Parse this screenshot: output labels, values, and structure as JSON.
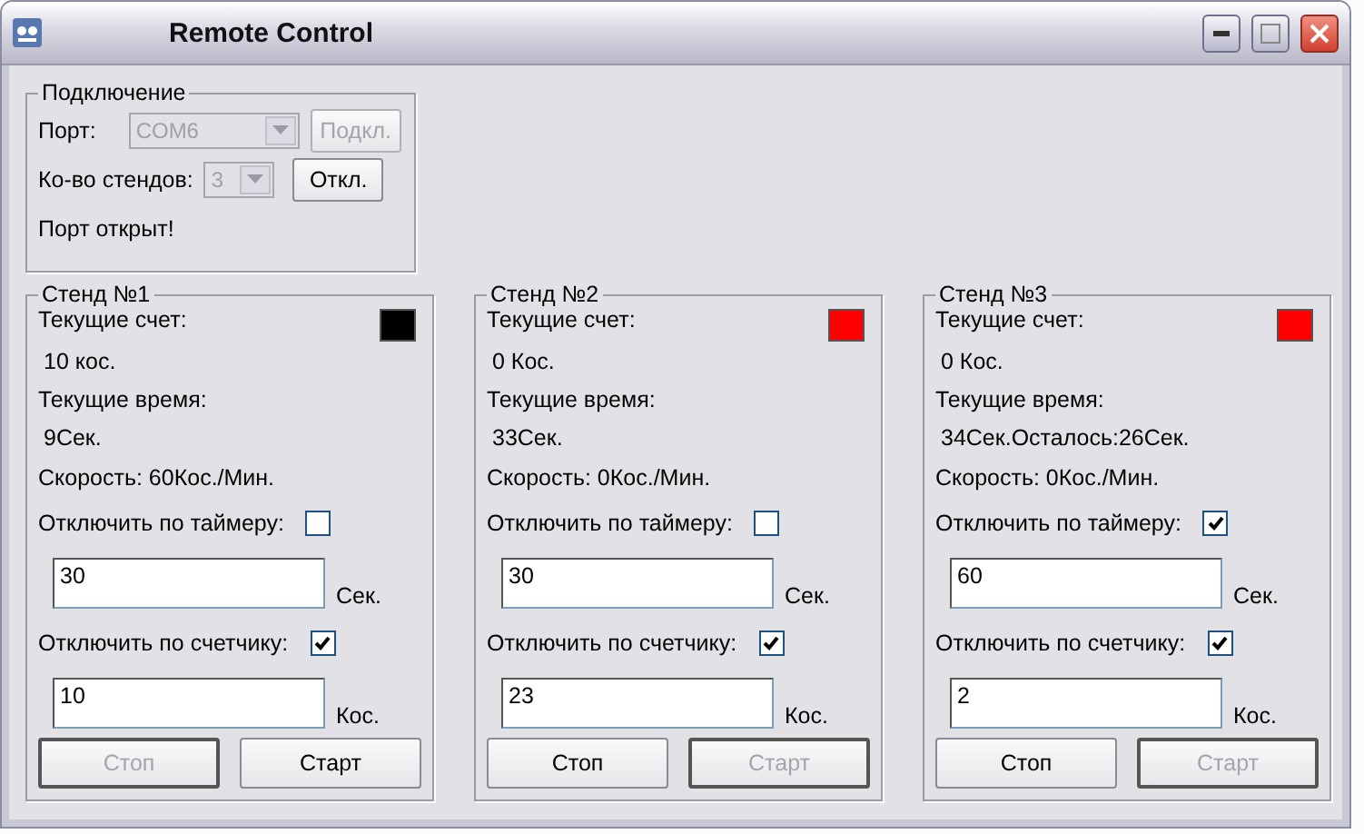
{
  "window": {
    "title": "Remote Control"
  },
  "connection": {
    "title": "Подключение",
    "port_label": "Порт:",
    "port_select": {
      "value": "COM6",
      "disabled": true
    },
    "connect_button": {
      "label": "Подкл.",
      "disabled": true
    },
    "stands_label": "Ко-во стендов:",
    "stands_select": {
      "value": "3",
      "disabled": true
    },
    "disconnect_button": {
      "label": "Откл.",
      "disabled": false
    },
    "status": "Порт открыт!"
  },
  "stands": [
    {
      "title": "Стенд №1",
      "color": "#000000",
      "count_label": "Текущие счет:",
      "count_value": "10 кос.",
      "time_label": "Текущие время:",
      "time_value": "9Сек.",
      "speed": "Скорость: 60Кос./Мин.",
      "timer_label": "Отключить по таймеру:",
      "timer_checked": false,
      "timer_value": "30",
      "timer_unit": "Сек.",
      "counter_label": "Отключить по счетчику:",
      "counter_checked": true,
      "counter_value": "10",
      "counter_unit": "Кос.",
      "stop_button": {
        "label": "Стоп",
        "disabled": true
      },
      "start_button": {
        "label": "Старт",
        "disabled": false
      }
    },
    {
      "title": "Стенд №2",
      "color": "#ff0000",
      "count_label": "Текущие счет:",
      "count_value": "0 Кос.",
      "time_label": "Текущие время:",
      "time_value": "33Сек.",
      "speed": "Скорость: 0Кос./Мин.",
      "timer_label": "Отключить по таймеру:",
      "timer_checked": false,
      "timer_value": "30",
      "timer_unit": "Сек.",
      "counter_label": "Отключить по счетчику:",
      "counter_checked": true,
      "counter_value": "23",
      "counter_unit": "Кос.",
      "stop_button": {
        "label": "Стоп",
        "disabled": false
      },
      "start_button": {
        "label": "Старт",
        "disabled": true
      }
    },
    {
      "title": "Стенд №3",
      "color": "#ff0000",
      "count_label": "Текущие счет:",
      "count_value": "0 Кос.",
      "time_label": "Текущие время:",
      "time_value": "34Сек.Осталось:26Сек.",
      "speed": "Скорость: 0Кос./Мин.",
      "timer_label": "Отключить по таймеру:",
      "timer_checked": true,
      "timer_value": "60",
      "timer_unit": "Сек.",
      "counter_label": "Отключить по счетчику:",
      "counter_checked": true,
      "counter_value": "2",
      "counter_unit": "Кос.",
      "stop_button": {
        "label": "Стоп",
        "disabled": false
      },
      "start_button": {
        "label": "Старт",
        "disabled": true
      }
    }
  ]
}
